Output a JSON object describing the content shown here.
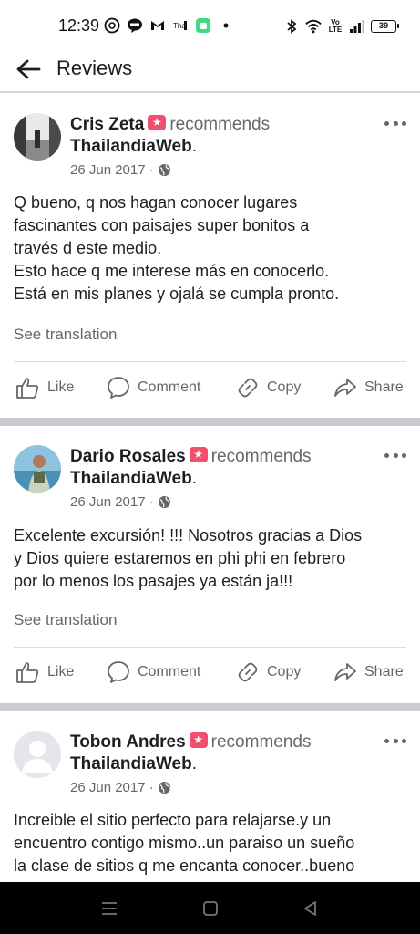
{
  "status_bar": {
    "time": "12:39",
    "volte": "Vo LTE",
    "battery": "39"
  },
  "header": {
    "title": "Reviews"
  },
  "reviews": [
    {
      "name": "Cris Zeta",
      "verb": "recommends",
      "page": "ThailandiaWeb",
      "date": "26 Jun 2017 ·",
      "text": [
        "Q bueno, q nos hagan conocer lugares",
        "fascinantes con paisajes super bonitos a",
        "través d este medio.",
        "Esto hace q me interese más en conocerlo.",
        "Está en mis planes y ojalá se cumpla pronto."
      ],
      "see_translation": "See translation",
      "actions": {
        "like": "Like",
        "comment": "Comment",
        "copy": "Copy",
        "share": "Share"
      }
    },
    {
      "name": "Dario Rosales",
      "verb": "recommends",
      "page": "ThailandiaWeb",
      "date": "26 Jun 2017 ·",
      "text": [
        "Excelente excursión! !!! Nosotros gracias a Dios",
        "y Dios quiere estaremos en phi phi en febrero",
        "por lo menos los pasajes ya están ja!!!"
      ],
      "see_translation": "See translation",
      "actions": {
        "like": "Like",
        "comment": "Comment",
        "copy": "Copy",
        "share": "Share"
      }
    },
    {
      "name": "Tobon Andres",
      "verb": "recommends",
      "page": "ThailandiaWeb",
      "date": "26 Jun 2017 ·",
      "text": [
        "Increible el sitio perfecto para relajarse.y un",
        "encuentro contigo mismo..un paraiso un sueño",
        "la clase de sitios q me encanta conocer..bueno"
      ]
    }
  ]
}
